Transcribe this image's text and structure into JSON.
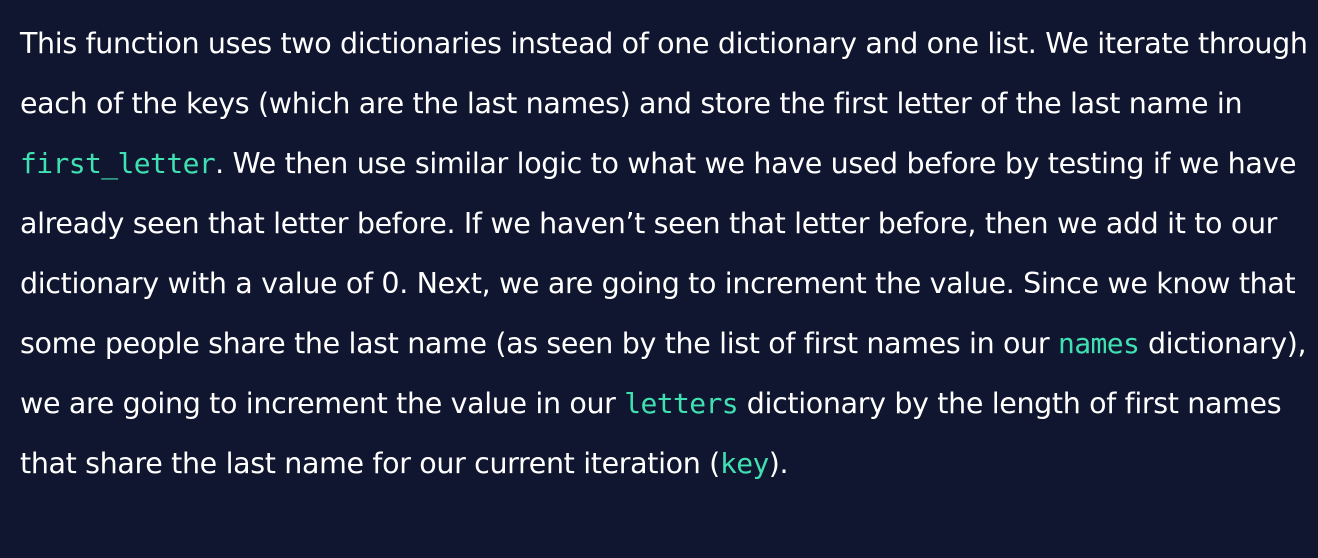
{
  "article": {
    "segments": [
      {
        "kind": "text",
        "text": "This function uses two dictionaries instead of one dictionary and one list. We iterate through each of the keys (which are the last names) and store the first letter of the last name in "
      },
      {
        "kind": "code",
        "text": "first_letter"
      },
      {
        "kind": "text",
        "text": ". We then use similar logic to what we have used before by testing if we have already seen that letter before. If we haven’t seen that letter before, then we add it to our dictionary with a value of 0. Next, we are going to increment the value. Since we know that some people share the last name (as seen by the list of first names in our "
      },
      {
        "kind": "code",
        "text": "names"
      },
      {
        "kind": "text",
        "text": " dictionary), we are going to increment the value in our "
      },
      {
        "kind": "code",
        "text": "letters"
      },
      {
        "kind": "text",
        "text": " dictionary by the length of first names that share the last name for our current iteration ("
      },
      {
        "kind": "code",
        "text": "key"
      },
      {
        "kind": "text",
        "text": ")."
      }
    ]
  },
  "theme": {
    "background": "#10162f",
    "text_color": "#ffffff",
    "code_color": "#3fe0b1"
  }
}
